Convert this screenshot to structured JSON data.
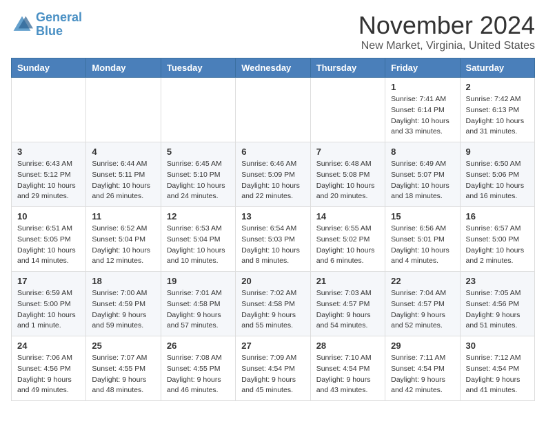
{
  "header": {
    "logo_line1": "General",
    "logo_line2": "Blue",
    "month": "November 2024",
    "location": "New Market, Virginia, United States"
  },
  "weekdays": [
    "Sunday",
    "Monday",
    "Tuesday",
    "Wednesday",
    "Thursday",
    "Friday",
    "Saturday"
  ],
  "weeks": [
    [
      {
        "day": "",
        "sunrise": "",
        "sunset": "",
        "daylight": ""
      },
      {
        "day": "",
        "sunrise": "",
        "sunset": "",
        "daylight": ""
      },
      {
        "day": "",
        "sunrise": "",
        "sunset": "",
        "daylight": ""
      },
      {
        "day": "",
        "sunrise": "",
        "sunset": "",
        "daylight": ""
      },
      {
        "day": "",
        "sunrise": "",
        "sunset": "",
        "daylight": ""
      },
      {
        "day": "1",
        "sunrise": "Sunrise: 7:41 AM",
        "sunset": "Sunset: 6:14 PM",
        "daylight": "Daylight: 10 hours and 33 minutes."
      },
      {
        "day": "2",
        "sunrise": "Sunrise: 7:42 AM",
        "sunset": "Sunset: 6:13 PM",
        "daylight": "Daylight: 10 hours and 31 minutes."
      }
    ],
    [
      {
        "day": "3",
        "sunrise": "Sunrise: 6:43 AM",
        "sunset": "Sunset: 5:12 PM",
        "daylight": "Daylight: 10 hours and 29 minutes."
      },
      {
        "day": "4",
        "sunrise": "Sunrise: 6:44 AM",
        "sunset": "Sunset: 5:11 PM",
        "daylight": "Daylight: 10 hours and 26 minutes."
      },
      {
        "day": "5",
        "sunrise": "Sunrise: 6:45 AM",
        "sunset": "Sunset: 5:10 PM",
        "daylight": "Daylight: 10 hours and 24 minutes."
      },
      {
        "day": "6",
        "sunrise": "Sunrise: 6:46 AM",
        "sunset": "Sunset: 5:09 PM",
        "daylight": "Daylight: 10 hours and 22 minutes."
      },
      {
        "day": "7",
        "sunrise": "Sunrise: 6:48 AM",
        "sunset": "Sunset: 5:08 PM",
        "daylight": "Daylight: 10 hours and 20 minutes."
      },
      {
        "day": "8",
        "sunrise": "Sunrise: 6:49 AM",
        "sunset": "Sunset: 5:07 PM",
        "daylight": "Daylight: 10 hours and 18 minutes."
      },
      {
        "day": "9",
        "sunrise": "Sunrise: 6:50 AM",
        "sunset": "Sunset: 5:06 PM",
        "daylight": "Daylight: 10 hours and 16 minutes."
      }
    ],
    [
      {
        "day": "10",
        "sunrise": "Sunrise: 6:51 AM",
        "sunset": "Sunset: 5:05 PM",
        "daylight": "Daylight: 10 hours and 14 minutes."
      },
      {
        "day": "11",
        "sunrise": "Sunrise: 6:52 AM",
        "sunset": "Sunset: 5:04 PM",
        "daylight": "Daylight: 10 hours and 12 minutes."
      },
      {
        "day": "12",
        "sunrise": "Sunrise: 6:53 AM",
        "sunset": "Sunset: 5:04 PM",
        "daylight": "Daylight: 10 hours and 10 minutes."
      },
      {
        "day": "13",
        "sunrise": "Sunrise: 6:54 AM",
        "sunset": "Sunset: 5:03 PM",
        "daylight": "Daylight: 10 hours and 8 minutes."
      },
      {
        "day": "14",
        "sunrise": "Sunrise: 6:55 AM",
        "sunset": "Sunset: 5:02 PM",
        "daylight": "Daylight: 10 hours and 6 minutes."
      },
      {
        "day": "15",
        "sunrise": "Sunrise: 6:56 AM",
        "sunset": "Sunset: 5:01 PM",
        "daylight": "Daylight: 10 hours and 4 minutes."
      },
      {
        "day": "16",
        "sunrise": "Sunrise: 6:57 AM",
        "sunset": "Sunset: 5:00 PM",
        "daylight": "Daylight: 10 hours and 2 minutes."
      }
    ],
    [
      {
        "day": "17",
        "sunrise": "Sunrise: 6:59 AM",
        "sunset": "Sunset: 5:00 PM",
        "daylight": "Daylight: 10 hours and 1 minute."
      },
      {
        "day": "18",
        "sunrise": "Sunrise: 7:00 AM",
        "sunset": "Sunset: 4:59 PM",
        "daylight": "Daylight: 9 hours and 59 minutes."
      },
      {
        "day": "19",
        "sunrise": "Sunrise: 7:01 AM",
        "sunset": "Sunset: 4:58 PM",
        "daylight": "Daylight: 9 hours and 57 minutes."
      },
      {
        "day": "20",
        "sunrise": "Sunrise: 7:02 AM",
        "sunset": "Sunset: 4:58 PM",
        "daylight": "Daylight: 9 hours and 55 minutes."
      },
      {
        "day": "21",
        "sunrise": "Sunrise: 7:03 AM",
        "sunset": "Sunset: 4:57 PM",
        "daylight": "Daylight: 9 hours and 54 minutes."
      },
      {
        "day": "22",
        "sunrise": "Sunrise: 7:04 AM",
        "sunset": "Sunset: 4:57 PM",
        "daylight": "Daylight: 9 hours and 52 minutes."
      },
      {
        "day": "23",
        "sunrise": "Sunrise: 7:05 AM",
        "sunset": "Sunset: 4:56 PM",
        "daylight": "Daylight: 9 hours and 51 minutes."
      }
    ],
    [
      {
        "day": "24",
        "sunrise": "Sunrise: 7:06 AM",
        "sunset": "Sunset: 4:56 PM",
        "daylight": "Daylight: 9 hours and 49 minutes."
      },
      {
        "day": "25",
        "sunrise": "Sunrise: 7:07 AM",
        "sunset": "Sunset: 4:55 PM",
        "daylight": "Daylight: 9 hours and 48 minutes."
      },
      {
        "day": "26",
        "sunrise": "Sunrise: 7:08 AM",
        "sunset": "Sunset: 4:55 PM",
        "daylight": "Daylight: 9 hours and 46 minutes."
      },
      {
        "day": "27",
        "sunrise": "Sunrise: 7:09 AM",
        "sunset": "Sunset: 4:54 PM",
        "daylight": "Daylight: 9 hours and 45 minutes."
      },
      {
        "day": "28",
        "sunrise": "Sunrise: 7:10 AM",
        "sunset": "Sunset: 4:54 PM",
        "daylight": "Daylight: 9 hours and 43 minutes."
      },
      {
        "day": "29",
        "sunrise": "Sunrise: 7:11 AM",
        "sunset": "Sunset: 4:54 PM",
        "daylight": "Daylight: 9 hours and 42 minutes."
      },
      {
        "day": "30",
        "sunrise": "Sunrise: 7:12 AM",
        "sunset": "Sunset: 4:54 PM",
        "daylight": "Daylight: 9 hours and 41 minutes."
      }
    ]
  ]
}
